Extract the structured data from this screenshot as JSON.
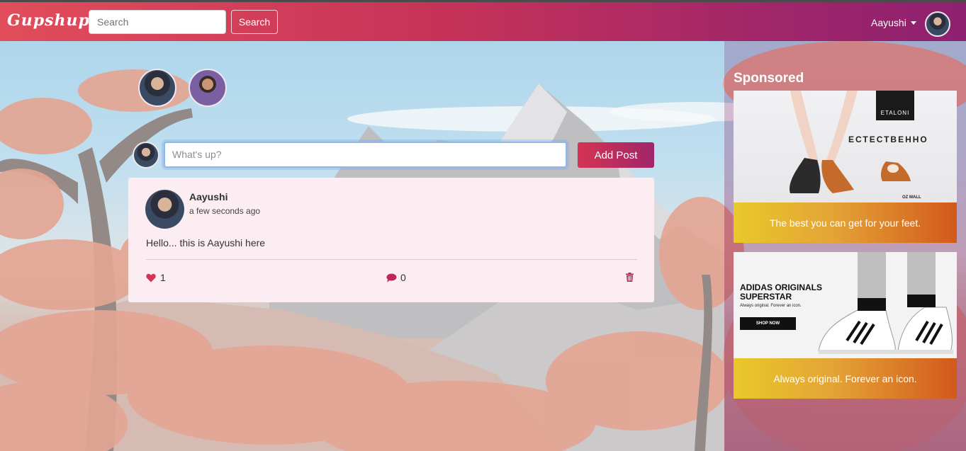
{
  "navbar": {
    "brand": "Gupshup",
    "search_placeholder": "Search",
    "search_button": "Search",
    "user_name": "Aayushi"
  },
  "composer": {
    "placeholder": "What's up?",
    "add_post_button": "Add Post"
  },
  "post": {
    "author": "Aayushi",
    "time": "a few seconds ago",
    "text": "Hello... this is Aayushi here",
    "likes": "1",
    "comments": "0"
  },
  "sponsored": {
    "title": "Sponsored",
    "ads": [
      {
        "caption": "The best you can get for your feet.",
        "brand": "ETALONI",
        "headline": "ЕСТЕСТВЕННО",
        "sub": "OZ MALL"
      },
      {
        "caption": "Always original. Forever an icon.",
        "headline": "ADIDAS ORIGINALS SUPERSTAR",
        "tagline": "Always original. Forever an icon.",
        "cta": "SHOP NOW"
      }
    ]
  },
  "colors": {
    "navbar_start": "#e24d5b",
    "navbar_end": "#8e2070",
    "accent": "#d53353",
    "post_bg": "#fcedf3",
    "heart": "#d63356",
    "comment_icon": "#c2255c",
    "trash_icon": "#c2255c"
  },
  "icons": [
    "heart-icon",
    "comment-icon",
    "trash-icon",
    "caret-down-icon"
  ]
}
